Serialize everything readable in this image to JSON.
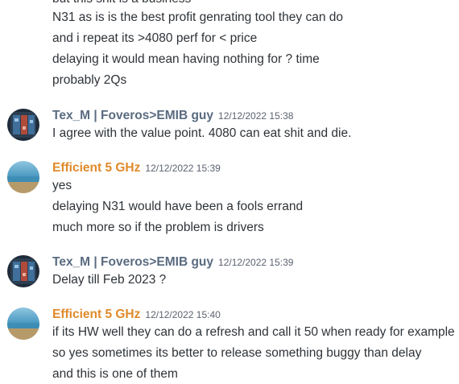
{
  "colors": {
    "tex_name": "#5a6b80",
    "efficient_name": "#e08a2a",
    "message_text": "#2e3338",
    "timestamp": "#5c6370"
  },
  "group1": {
    "lines": [
      "but this shit is a business",
      "N31 as is is the best profit genrating tool they can do",
      "and i repeat its >4080 perf for < price",
      "delaying it would mean having nothing for ? time",
      "probably 2Qs"
    ]
  },
  "msg1": {
    "author": "Tex_M | Foveros>EMIB guy",
    "timestamp": "12/12/2022 15:38",
    "avatar_icon": "chip-avatar-icon",
    "lines": [
      "I agree with the value point. 4080 can eat shit and die."
    ]
  },
  "msg2": {
    "author": "Efficient 5 GHz",
    "timestamp": "12/12/2022 15:39",
    "avatar_icon": "beach-avatar-icon",
    "lines": [
      "yes",
      "delaying N31 would have been a fools errand",
      "much more so if the problem is drivers"
    ]
  },
  "msg3": {
    "author": "Tex_M | Foveros>EMIB guy",
    "timestamp": "12/12/2022 15:39",
    "avatar_icon": "chip-avatar-icon",
    "lines": [
      "Delay till Feb 2023 ?"
    ]
  },
  "msg4": {
    "author": "Efficient 5 GHz",
    "timestamp": "12/12/2022 15:40",
    "avatar_icon": "beach-avatar-icon",
    "lines": [
      "if its HW well they can do a refresh and call it 50 when ready for example",
      "so yes sometimes its better to release something buggy than delay",
      "and this is one of them"
    ]
  }
}
